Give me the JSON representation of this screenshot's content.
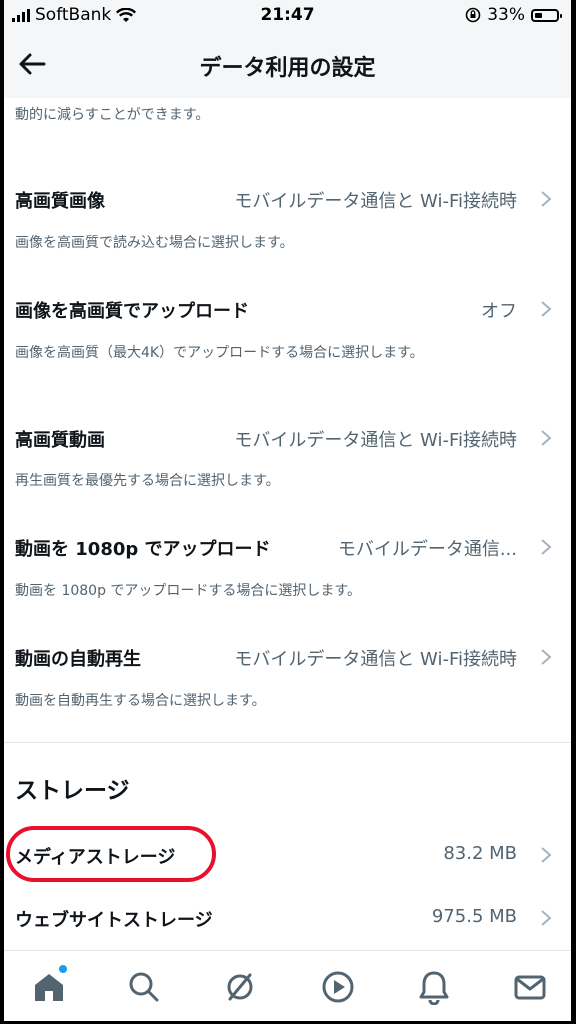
{
  "status_bar": {
    "carrier": "SoftBank",
    "time": "21:47",
    "battery_percent_label": "33%",
    "battery_level": 0.33
  },
  "header": {
    "title": "データ利用の設定"
  },
  "intro_text": "動的に減らすことができます。",
  "settings": [
    {
      "label": "高画質画像",
      "value": "モバイルデータ通信と Wi-Fi接続時",
      "description": "画像を高画質で読み込む場合に選択します。"
    },
    {
      "label": "画像を高画質でアップロード",
      "value": "オフ",
      "description": "画像を高画質（最大4K）でアップロードする場合に選択します。"
    },
    {
      "label": "高画質動画",
      "value": "モバイルデータ通信と Wi-Fi接続時",
      "description": "再生画質を最優先する場合に選択します。"
    },
    {
      "label": "動画を 1080p でアップロード",
      "value": "モバイルデータ通信...",
      "description": "動画を 1080p でアップロードする場合に選択します。"
    },
    {
      "label": "動画の自動再生",
      "value": "モバイルデータ通信と Wi-Fi接続時",
      "description": "動画を自動再生する場合に選択します。"
    }
  ],
  "storage": {
    "section_title": "ストレージ",
    "items": [
      {
        "label": "メディアストレージ",
        "value": "83.2 MB"
      },
      {
        "label": "ウェブサイトストレージ",
        "value": "975.5 MB"
      }
    ]
  },
  "tabbar": {
    "items": [
      "home-icon",
      "search-icon",
      "spaces-icon",
      "video-icon",
      "notifications-icon",
      "messages-icon"
    ]
  },
  "colors": {
    "accent": "#1d9bf0",
    "highlight_circle": "#e8112d",
    "text_primary": "#0f1419",
    "text_secondary": "#536471"
  }
}
